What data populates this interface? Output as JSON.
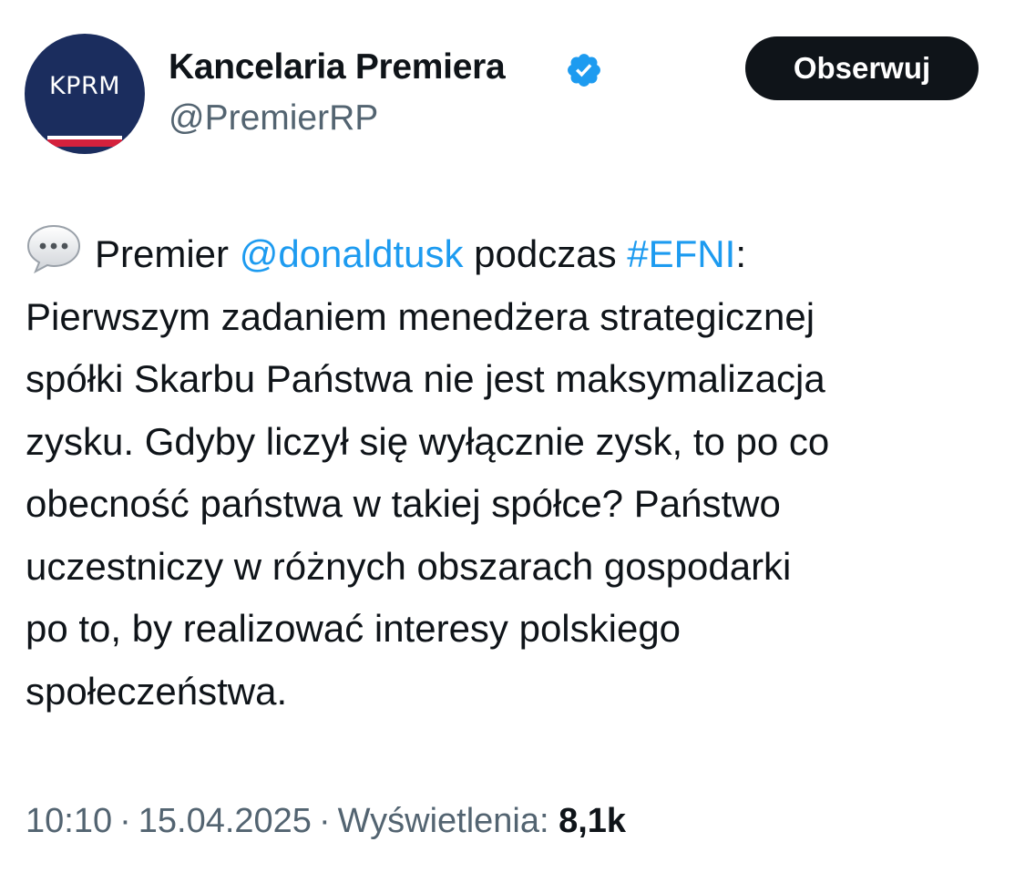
{
  "author": {
    "avatar_text": "KPRM",
    "display_name": "Kancelaria Premiera",
    "handle": "@PremierRP",
    "verified_icon": "verified-badge-icon",
    "follow_label": "Obserwuj"
  },
  "tweet": {
    "emoji_icon": "speech-balloon-icon",
    "line1": {
      "prefix": "Premier ",
      "mention": "@donaldtusk",
      "middle": " podczas ",
      "hashtag": "#EFNI",
      "suffix": ":"
    },
    "lines": [
      "Pierwszym zadaniem menedżera strategicznej",
      "spółki Skarbu Państwa nie jest maksymalizacja",
      "zysku. Gdyby liczył się wyłącznie zysk, to po co",
      "obecność państwa w takiej spółce? Państwo",
      "uczestniczy w różnych obszarach gospodarki",
      "po to, by realizować interesy polskiego",
      "społeczeństwa."
    ]
  },
  "meta": {
    "time": "10:10",
    "separator": "·",
    "date": "15.04.2025",
    "views_label": "Wyświetlenia:",
    "views_count": "8,1k"
  },
  "colors": {
    "accent_link": "#1d9bf0",
    "verified": "#1d9bf0",
    "avatar_bg": "#1b2d5e",
    "flag_red": "#d4213d",
    "muted_text": "#536471",
    "primary_text": "#0f1419"
  }
}
